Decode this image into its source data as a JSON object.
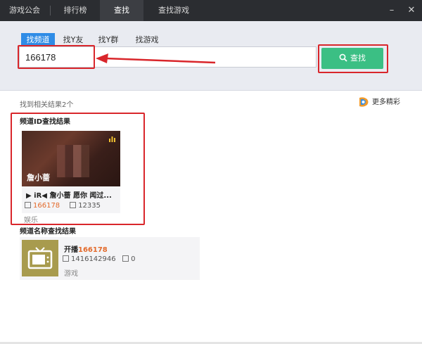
{
  "topbar": {
    "tabs": [
      {
        "label": "游戏公会"
      },
      {
        "label": "排行榜"
      },
      {
        "label": "查找"
      },
      {
        "label": "查找游戏"
      }
    ],
    "minimize": "–",
    "close": "✕"
  },
  "search": {
    "subtabs": [
      {
        "label": "找频道"
      },
      {
        "label": "找Y友"
      },
      {
        "label": "找Y群"
      },
      {
        "label": "找游戏"
      }
    ],
    "value": "166178",
    "button_label": "查找"
  },
  "results": {
    "count_text": "找到相关结果2个",
    "more_label": "更多精彩",
    "id_section_title": "频道ID查找结果",
    "id_card": {
      "thumb_name": "詹小蔷",
      "title": "▶ iR◀ 詹小蔷 愿你 闻过...",
      "channel_id": "166178",
      "online": "12335",
      "category": "娱乐"
    },
    "name_section_title": "频道名称查找结果",
    "name_card": {
      "title_prefix": "开播",
      "title_highlight": "166178",
      "long_id": "1416142946",
      "online": "0",
      "category": "游戏"
    }
  },
  "colors": {
    "accent": "#2f8ce6",
    "search_button": "#3bbf84",
    "highlight": "#e36a2b",
    "annotation": "#d9262b"
  }
}
